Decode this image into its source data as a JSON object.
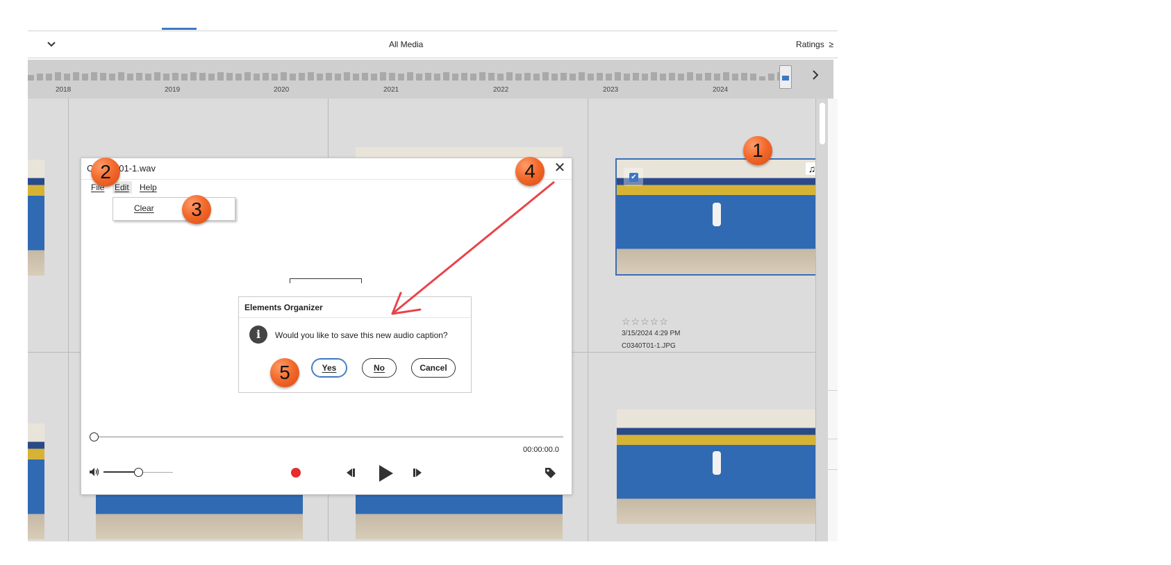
{
  "toolbar": {
    "title": "All Media",
    "ratings_label": "Ratings",
    "ratings_symbol": "≥"
  },
  "timeline": {
    "years": [
      "2018",
      "2019",
      "2020",
      "2021",
      "2022",
      "2023",
      "2024"
    ]
  },
  "selected_item": {
    "rating_stars": "☆☆☆☆☆",
    "date": "3/15/2024 4:29 PM",
    "filename": "C0340T01-1.JPG"
  },
  "audio_window": {
    "title": "C0340T01-1.wav",
    "menu": {
      "file": "File",
      "edit": "Edit",
      "help": "Help"
    },
    "edit_menu_items": [
      "Clear"
    ],
    "time": "00:00:00.0"
  },
  "dialog": {
    "title": "Elements Organizer",
    "message": "Would you like to save this new audio caption?",
    "yes": "Yes",
    "no": "No",
    "cancel": "Cancel"
  },
  "step_badges": [
    "1",
    "2",
    "3",
    "4",
    "5"
  ],
  "colors": {
    "accent": "#3b78c4",
    "badge": "#f36a2c",
    "record": "#e42d2d",
    "arrow": "#e8434a"
  }
}
